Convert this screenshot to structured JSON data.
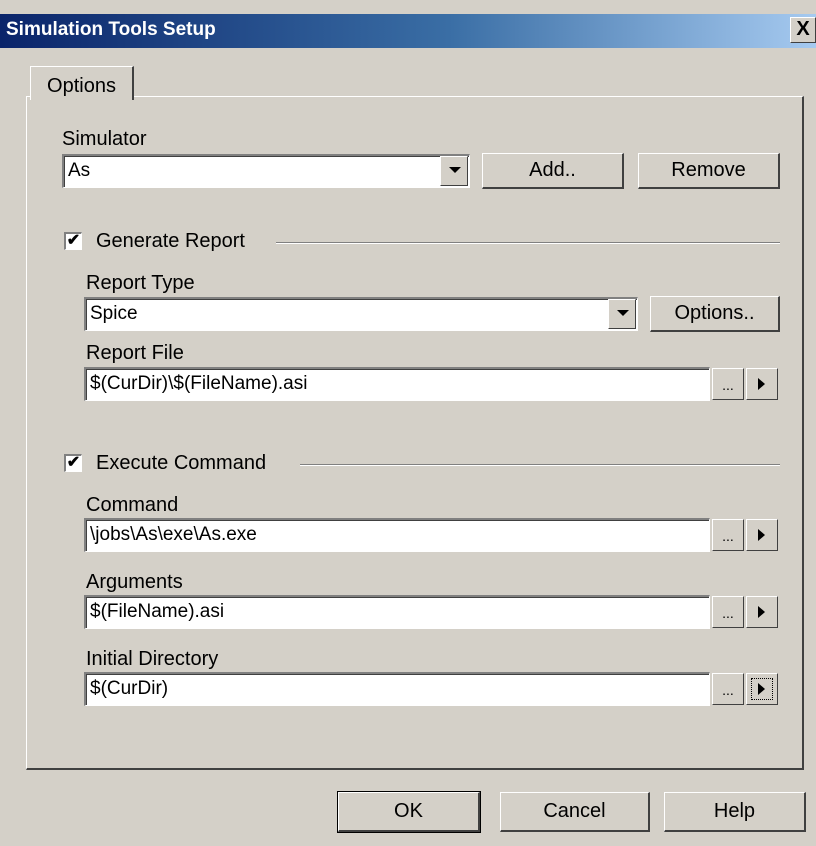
{
  "window": {
    "title": "Simulation Tools Setup",
    "close_glyph": "X"
  },
  "tabs": [
    {
      "label": "Options"
    }
  ],
  "simulator": {
    "label": "Simulator",
    "selected": "As",
    "add_label": "Add..",
    "remove_label": "Remove"
  },
  "generate_report": {
    "label": "Generate Report",
    "checked": true,
    "report_type": {
      "label": "Report Type",
      "selected": "Spice",
      "options_label": "Options.."
    },
    "report_file": {
      "label": "Report File",
      "value": "$(CurDir)\\$(FileName).asi"
    }
  },
  "execute_command": {
    "label": "Execute Command",
    "checked": true,
    "command": {
      "label": "Command",
      "value": "\\jobs\\As\\exe\\As.exe"
    },
    "arguments": {
      "label": "Arguments",
      "value": "$(FileName).asi"
    },
    "initial_directory": {
      "label": "Initial Directory",
      "value": "$(CurDir)"
    }
  },
  "browse_label": "...",
  "check_glyph": "✔",
  "footer": {
    "ok_label": "OK",
    "cancel_label": "Cancel",
    "help_label": "Help"
  }
}
